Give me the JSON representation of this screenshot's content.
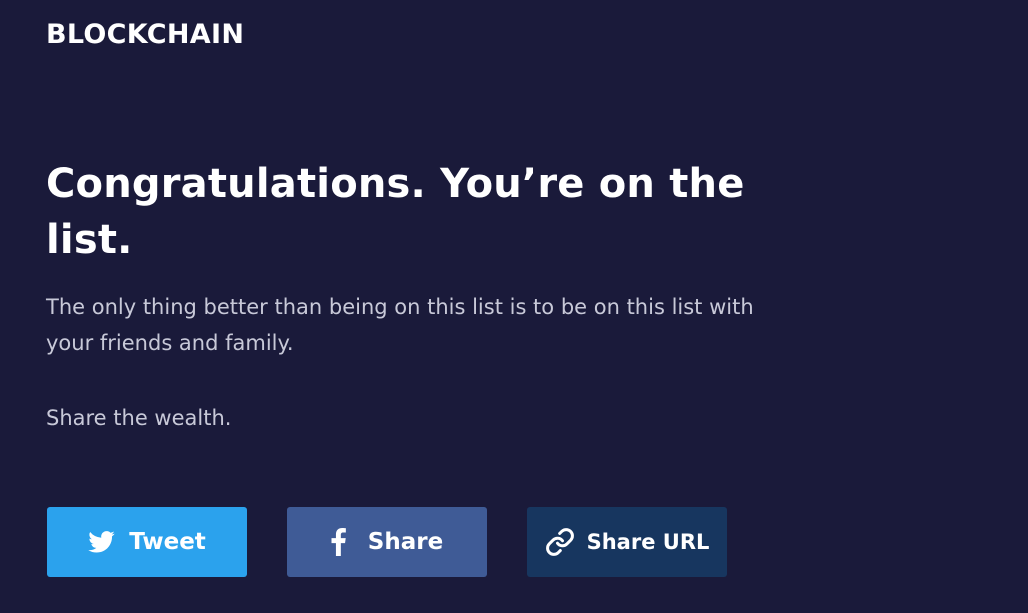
{
  "header": {
    "logo_text": "BLOCKCHAIN"
  },
  "main": {
    "headline": "Congratulations. You’re on the list.",
    "body": "The only thing better than being on this list is to be on this list with your friends and family.",
    "tagline": "Share the wealth."
  },
  "share": {
    "tweet": {
      "label": "Tweet",
      "icon": "twitter-icon",
      "color": "#2ba2ed"
    },
    "facebook": {
      "label": "Share",
      "icon": "facebook-icon",
      "color": "#3f5b96"
    },
    "url": {
      "label": "Share URL",
      "icon": "link-icon",
      "color": "#17365f"
    }
  },
  "colors": {
    "background": "#1a1a3a",
    "text_primary": "#ffffff",
    "text_secondary": "#c8c9d8"
  }
}
